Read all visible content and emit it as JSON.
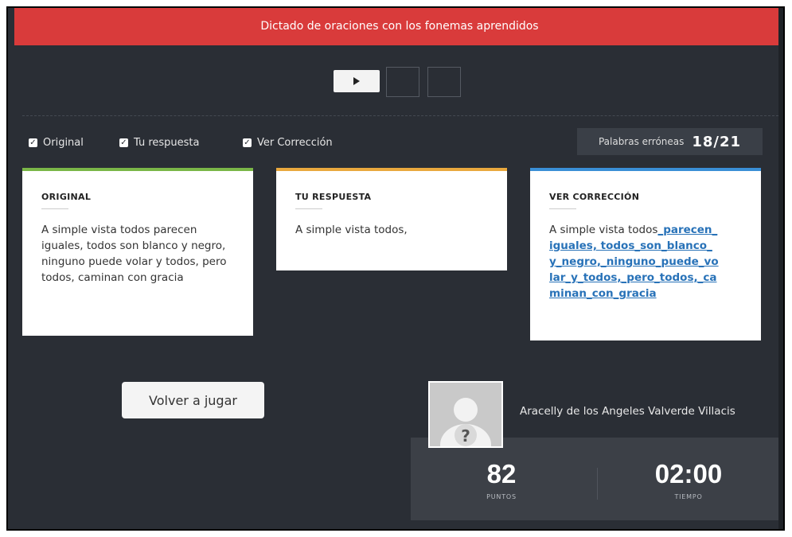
{
  "header": {
    "title": "Dictado de oraciones con los fonemas aprendidos"
  },
  "options": [
    {
      "label": "Original",
      "checked": true
    },
    {
      "label": "Tu respuesta",
      "checked": true
    },
    {
      "label": "Ver Corrección",
      "checked": true
    }
  ],
  "errors": {
    "label": "Palabras erróneas",
    "count": "18/21"
  },
  "cards": {
    "original": {
      "title": "ORIGINAL",
      "text": "A simple vista todos parecen iguales, todos son blanco y negro, ninguno puede volar y todos, pero todos, caminan con gracia"
    },
    "answer": {
      "title": "TU RESPUESTA",
      "text": "A simple vista todos,"
    },
    "correction": {
      "title": "VER CORRECCIÓN",
      "plain": "A simple vista todos",
      "lines": [
        "_parecen_",
        "iguales, todos_son_blanco_",
        "y_negro,_ninguno_puede_vo",
        "lar_y_todos,_pero_todos,_ca",
        "minan_con_gracia"
      ]
    }
  },
  "replay_label": "Volver a jugar",
  "user": {
    "name": "Aracelly de los Angeles Valverde Villacis"
  },
  "stats": {
    "points": "82",
    "points_label": "PUNTOS",
    "time": "02:00",
    "time_label": "TIEMPO"
  },
  "colors": {
    "banner": "#d93b3b",
    "background": "#2a2e35",
    "original_accent": "#7ab648",
    "answer_accent": "#e9a83e",
    "correction_accent": "#3a8fd6",
    "correction_link": "#2872b8"
  }
}
